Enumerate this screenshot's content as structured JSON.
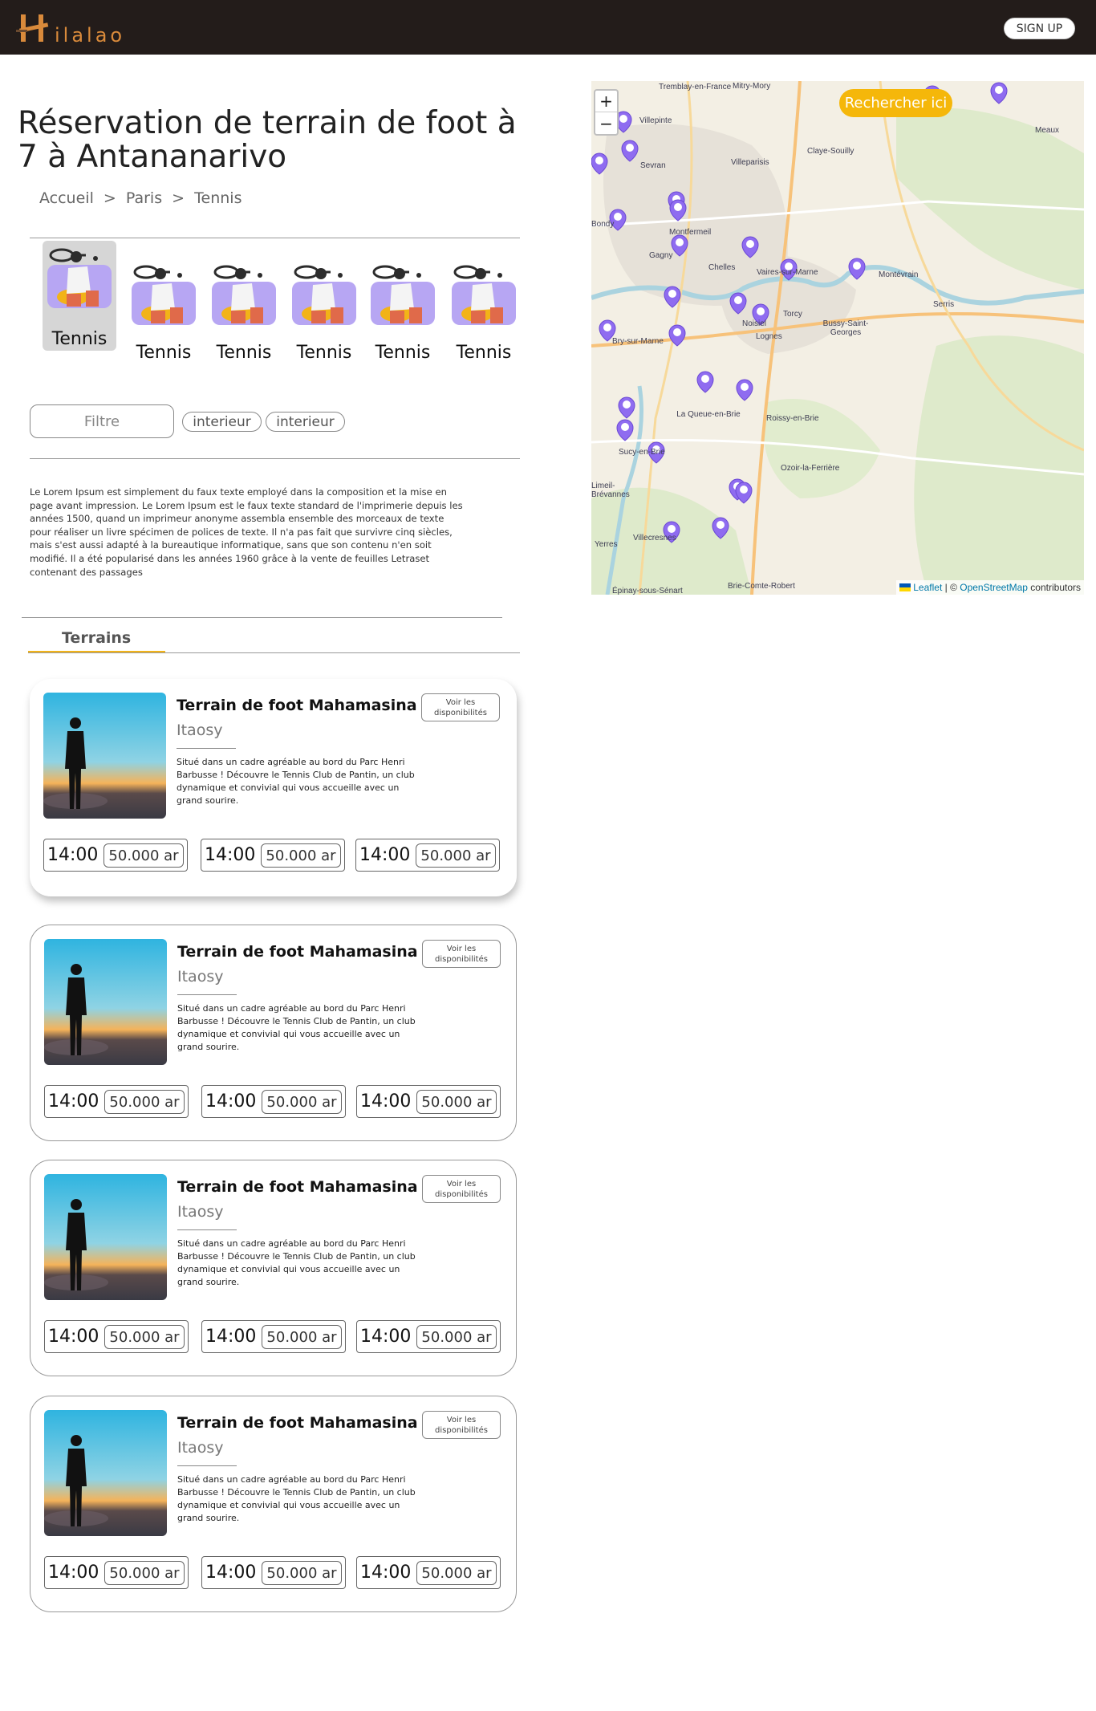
{
  "header": {
    "logo_text": "ilalao",
    "signup_label": "SIGN UP"
  },
  "hero": {
    "title": "Réservation de terrain de foot à 7 à Antananarivo",
    "breadcrumb": [
      "Accueil",
      ">",
      "Paris",
      ">",
      "Tennis"
    ]
  },
  "sports": [
    {
      "label": "Tennis",
      "icon": "tennis-player-icon",
      "active": true
    },
    {
      "label": "Tennis",
      "icon": "tennis-player-icon",
      "active": false
    },
    {
      "label": "Tennis",
      "icon": "tennis-player-icon",
      "active": false
    },
    {
      "label": "Tennis",
      "icon": "tennis-player-icon",
      "active": false
    },
    {
      "label": "Tennis",
      "icon": "tennis-player-icon",
      "active": false
    },
    {
      "label": "Tennis",
      "icon": "tennis-player-icon",
      "active": false
    }
  ],
  "filters": {
    "main_label": "Filtre",
    "chips": [
      "interieur",
      "interieur"
    ]
  },
  "description": "Le Lorem Ipsum est simplement du faux texte employé dans la composition et la mise en page avant impression. Le Lorem Ipsum est le faux texte standard de l'imprimerie depuis les années 1500, quand un imprimeur anonyme assembla ensemble des morceaux de texte pour réaliser un livre spécimen de polices de texte. Il n'a pas fait que survivre cinq siècles, mais s'est aussi adapté à la bureautique informatique, sans que son contenu n'en soit modifié. Il a été popularisé dans les années 1960 grâce à la vente de feuilles Letraset contenant des passages",
  "terrains_heading": "Terrains",
  "cards": [
    {
      "title": "Terrain de foot Mahamasina",
      "location": "Itaosy",
      "description": "Situé dans un cadre agréable au bord du Parc Henri Barbusse ! Découvre le Tennis Club de Pantin, un club dynamique et convivial qui vous accueille avec un grand sourire.",
      "availability_label": "Voir les disponibilités",
      "slots": [
        {
          "time": "14:00",
          "price": "50.000 ar"
        },
        {
          "time": "14:00",
          "price": "50.000 ar"
        },
        {
          "time": "14:00",
          "price": "50.000 ar"
        }
      ]
    },
    {
      "title": "Terrain de foot Mahamasina",
      "location": "Itaosy",
      "description": "Situé dans un cadre agréable au bord du Parc Henri Barbusse ! Découvre le Tennis Club de Pantin, un club dynamique et convivial qui vous accueille avec un grand sourire.",
      "availability_label": "Voir les disponibilités",
      "slots": [
        {
          "time": "14:00",
          "price": "50.000 ar"
        },
        {
          "time": "14:00",
          "price": "50.000 ar"
        },
        {
          "time": "14:00",
          "price": "50.000 ar"
        }
      ]
    },
    {
      "title": "Terrain de foot Mahamasina",
      "location": "Itaosy",
      "description": "Situé dans un cadre agréable au bord du Parc Henri Barbusse ! Découvre le Tennis Club de Pantin, un club dynamique et convivial qui vous accueille avec un grand sourire.",
      "availability_label": "Voir les disponibilités",
      "slots": [
        {
          "time": "14:00",
          "price": "50.000 ar"
        },
        {
          "time": "14:00",
          "price": "50.000 ar"
        },
        {
          "time": "14:00",
          "price": "50.000 ar"
        }
      ]
    },
    {
      "title": "Terrain de foot Mahamasina",
      "location": "Itaosy",
      "description": "Situé dans un cadre agréable au bord du Parc Henri Barbusse ! Découvre le Tennis Club de Pantin, un club dynamique et convivial qui vous accueille avec un grand sourire.",
      "availability_label": "Voir les disponibilités",
      "slots": [
        {
          "time": "14:00",
          "price": "50.000 ar"
        },
        {
          "time": "14:00",
          "price": "50.000 ar"
        },
        {
          "time": "14:00",
          "price": "50.000 ar"
        }
      ]
    }
  ],
  "map": {
    "zoom_in": "+",
    "zoom_out": "−",
    "search_button": "Rechercher ici",
    "attribution": {
      "leaflet": "Leaflet",
      "sep": " | © ",
      "osm": "OpenStreetMap",
      "tail": " contributors"
    },
    "places": [
      "Tremblay-en-France",
      "Mitry-Mory",
      "Villepinte",
      "Meaux",
      "Sevran",
      "Villeparisis",
      "Claye-Souilly",
      "Bondy",
      "Montfermeil",
      "Gagny",
      "Chelles",
      "Vaires-sur-Marne",
      "Montévrain",
      "Serris",
      "Torcy",
      "Noisiel",
      "Lognes",
      "Bussy-Saint-Georges",
      "Bry-sur-Marne",
      "La Queue-en-Brie",
      "Roissy-en-Brie",
      "Sucy-en-Brie",
      "Ozoir-la-Ferrière",
      "Limeil-Brévannes",
      "Villecresnes",
      "Yerres",
      "Brie-Comte-Robert",
      "Épinay-sous-Sénart"
    ],
    "colors": {
      "accent": "#f5b70a",
      "marker": "#8f6cf0"
    }
  }
}
